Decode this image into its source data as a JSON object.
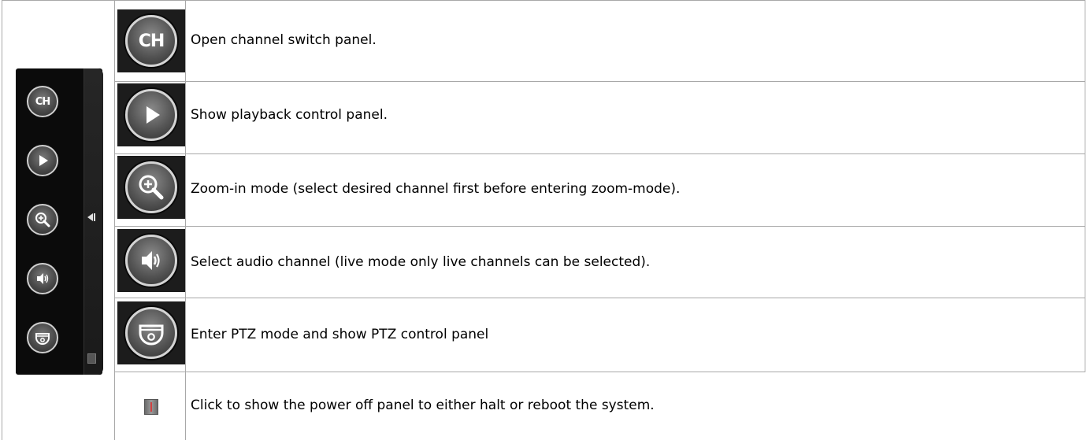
{
  "rows": [
    {
      "icon": "ch-icon",
      "label": "CH",
      "text": "Open channel switch panel."
    },
    {
      "icon": "play-icon",
      "text": "Show playback control panel."
    },
    {
      "icon": "zoom-in-icon",
      "text": "Zoom-in mode (select desired channel first before entering zoom-mode)."
    },
    {
      "icon": "audio-icon",
      "text": "Select audio channel (live mode only live channels can be selected)."
    },
    {
      "icon": "ptz-camera-icon",
      "text": "Enter PTZ mode and show PTZ control panel"
    },
    {
      "icon": "power-icon",
      "text": "Click to show the power off panel to either halt or reboot the system."
    }
  ],
  "toolbar": {
    "ch_label": "CH"
  }
}
